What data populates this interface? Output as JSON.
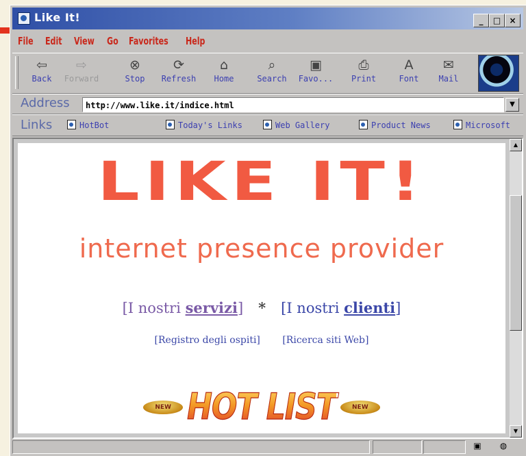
{
  "window": {
    "title": "Like It!"
  },
  "menu": [
    "File",
    "Edit",
    "View",
    "Go",
    "Favorites",
    "Help"
  ],
  "toolbar": [
    {
      "label": "Back",
      "icon": "back-arrow-icon",
      "glyph": "⇦",
      "enabled": true
    },
    {
      "label": "Forward",
      "icon": "forward-arrow-icon",
      "glyph": "⇨",
      "enabled": false
    },
    {
      "label": "Stop",
      "icon": "stop-icon",
      "glyph": "⊗",
      "enabled": true
    },
    {
      "label": "Refresh",
      "icon": "refresh-icon",
      "glyph": "⟳",
      "enabled": true
    },
    {
      "label": "Home",
      "icon": "home-icon",
      "glyph": "⌂",
      "enabled": true
    },
    {
      "label": "Search",
      "icon": "search-icon",
      "glyph": "⌕",
      "enabled": true
    },
    {
      "label": "Favo...",
      "icon": "favorites-folder-icon",
      "glyph": "▣",
      "enabled": true
    },
    {
      "label": "Print",
      "icon": "printer-icon",
      "glyph": "⎙",
      "enabled": true
    },
    {
      "label": "Font",
      "icon": "font-icon",
      "glyph": "A",
      "enabled": true
    },
    {
      "label": "Mail",
      "icon": "mail-icon",
      "glyph": "✉",
      "enabled": true
    }
  ],
  "address": {
    "label": "Address",
    "url": "http://www.like.it/indice.html"
  },
  "links": {
    "label": "Links",
    "items": [
      "HotBot",
      "Today's Links",
      "Web Gallery",
      "Product News",
      "Microsoft"
    ]
  },
  "page": {
    "logo_text": "LIKE IT!",
    "tagline": "internet presence provider",
    "nav": {
      "servizi_prefix": "[I nostri ",
      "servizi_bold": "servizi",
      "servizi_suffix": "]",
      "separator": "*",
      "clienti_prefix": "[I nostri ",
      "clienti_bold": "clienti",
      "clienti_suffix": "]"
    },
    "sublinks": [
      "[Registro degli ospiti]",
      "[Ricerca siti Web]"
    ],
    "hotlist": {
      "title": "HOT LIST",
      "badge": "NEW"
    }
  },
  "colors": {
    "accent": "#f15a42",
    "menu": "#c9281b",
    "link": "#3b47a8",
    "visited": "#7a5aa6"
  }
}
